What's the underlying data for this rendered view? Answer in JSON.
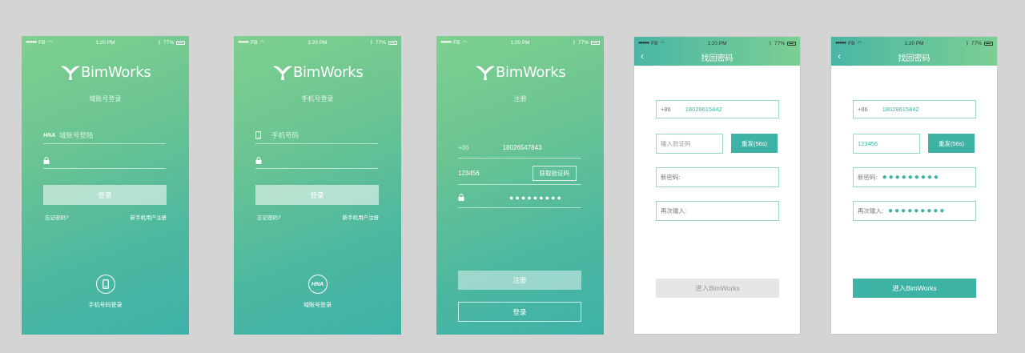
{
  "status": {
    "carrier": "FB",
    "time": "1:20 PM",
    "battery": "77%"
  },
  "brand": {
    "name": "BimWorks"
  },
  "screen1": {
    "subtitle": "域账号登录",
    "account_placeholder": "域账号登陆",
    "account_icon": "HNA",
    "login_label": "登录",
    "forgot_label": "忘记密码?",
    "register_link": "新手机用户注册",
    "bottom_label": "手机号码登录"
  },
  "screen2": {
    "subtitle": "手机号登录",
    "phone_placeholder": "手机号码",
    "login_label": "登录",
    "forgot_label": "忘记密码?",
    "register_link": "新手机用户注册",
    "bottom_icon": "HNA",
    "bottom_label": "域账号登录"
  },
  "screen3": {
    "subtitle": "注册",
    "country_code": "+86",
    "phone_value": "18026547843",
    "code_value": "123456",
    "get_code_label": "获取验证码",
    "password_dots": "●●●●●●●●●",
    "register_label": "注册",
    "login_label": "登录"
  },
  "screen4": {
    "title": "找回密码",
    "country_code": "+86",
    "phone_value": "18029615842",
    "code_placeholder": "输入验证码",
    "resend_label": "重发(56s)",
    "new_pwd_label": "新密码:",
    "repeat_label": "再次输入:",
    "enter_label": "进入BimWorks"
  },
  "screen5": {
    "title": "找回密码",
    "country_code": "+86",
    "phone_value": "18029615842",
    "code_value": "123456",
    "resend_label": "重发(56s)",
    "new_pwd_label": "新密码:",
    "repeat_label": "再次输入:",
    "password_dots": "●●●●●●●●●",
    "enter_label": "进入BimWorks"
  },
  "colors": {
    "accent": "#3db3a5",
    "gradient_top": "#7ed08e",
    "gradient_bottom": "#3eb1a8"
  }
}
